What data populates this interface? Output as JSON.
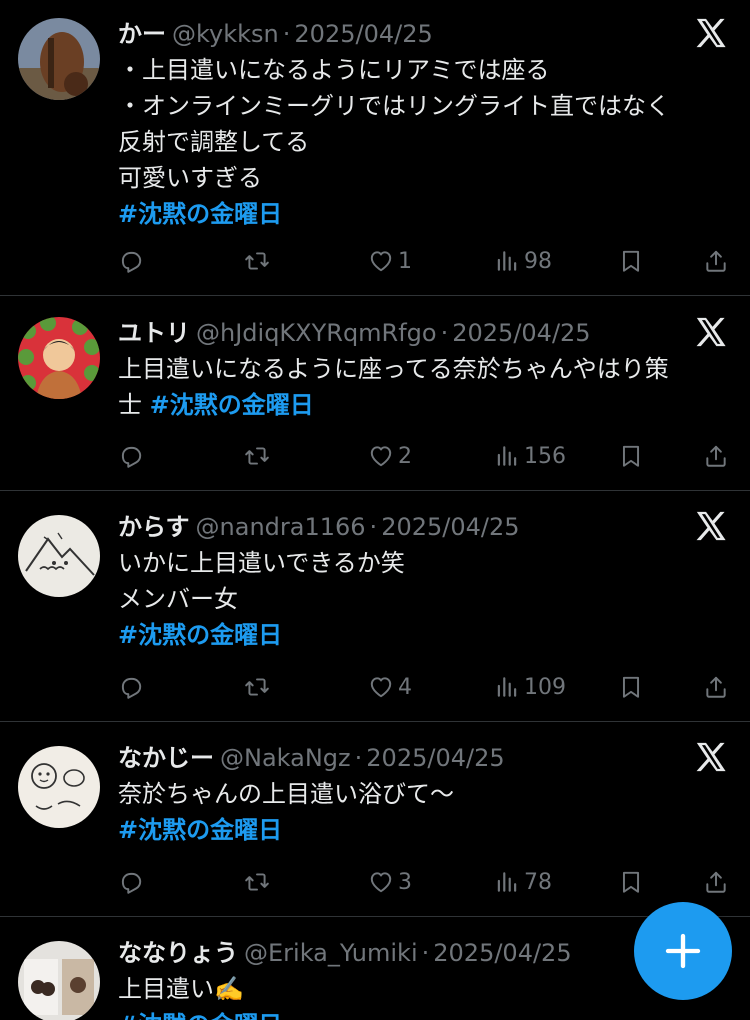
{
  "colors": {
    "background": "#000000",
    "accent": "#1d9bf0",
    "muted": "#71767b",
    "text": "#e7e9ea"
  },
  "icons": {
    "reply": "reply-icon",
    "retweet": "retweet-icon",
    "like": "heart-icon",
    "views": "views-icon",
    "bookmark": "bookmark-icon",
    "share": "share-icon",
    "brand": "x-logo-icon",
    "compose": "plus-icon"
  },
  "tweets": [
    {
      "name": "かー",
      "handle": "@kykksn",
      "separator": "·",
      "date": "2025/04/25",
      "lines": [
        "・上目遣いになるようにリアミでは座る",
        "・オンラインミーグリではリングライト直ではなく",
        "反射で調整してる",
        "可愛いすぎる"
      ],
      "hashtag": "#沈黙の金曜日",
      "likes": "1",
      "views": "98"
    },
    {
      "name": "ユトリ",
      "handle": "@hJdiqKXYRqmRfgo",
      "separator": "·",
      "date": "2025/04/25",
      "lines": [
        "上目遣いになるように座ってる奈於ちゃんやはり策",
        "士"
      ],
      "hashtag": "#沈黙の金曜日",
      "likes": "2",
      "views": "156"
    },
    {
      "name": "からす",
      "handle": "@nandra1166",
      "separator": "·",
      "date": "2025/04/25",
      "lines": [
        "いかに上目遣いできるか笑",
        "メンバー女"
      ],
      "hashtag": "#沈黙の金曜日",
      "likes": "4",
      "views": "109"
    },
    {
      "name": "なかじー",
      "handle": "@NakaNgz",
      "separator": "·",
      "date": "2025/04/25",
      "lines": [
        "奈於ちゃんの上目遣い浴びて〜"
      ],
      "hashtag": "#沈黙の金曜日",
      "likes": "3",
      "views": "78"
    },
    {
      "name": "ななりょう",
      "handle": "@Erika_Yumiki",
      "separator": "·",
      "date": "2025/04/25",
      "lines": [
        "上目遣い✍️"
      ],
      "hashtag": "#沈黙の金曜日"
    }
  ]
}
